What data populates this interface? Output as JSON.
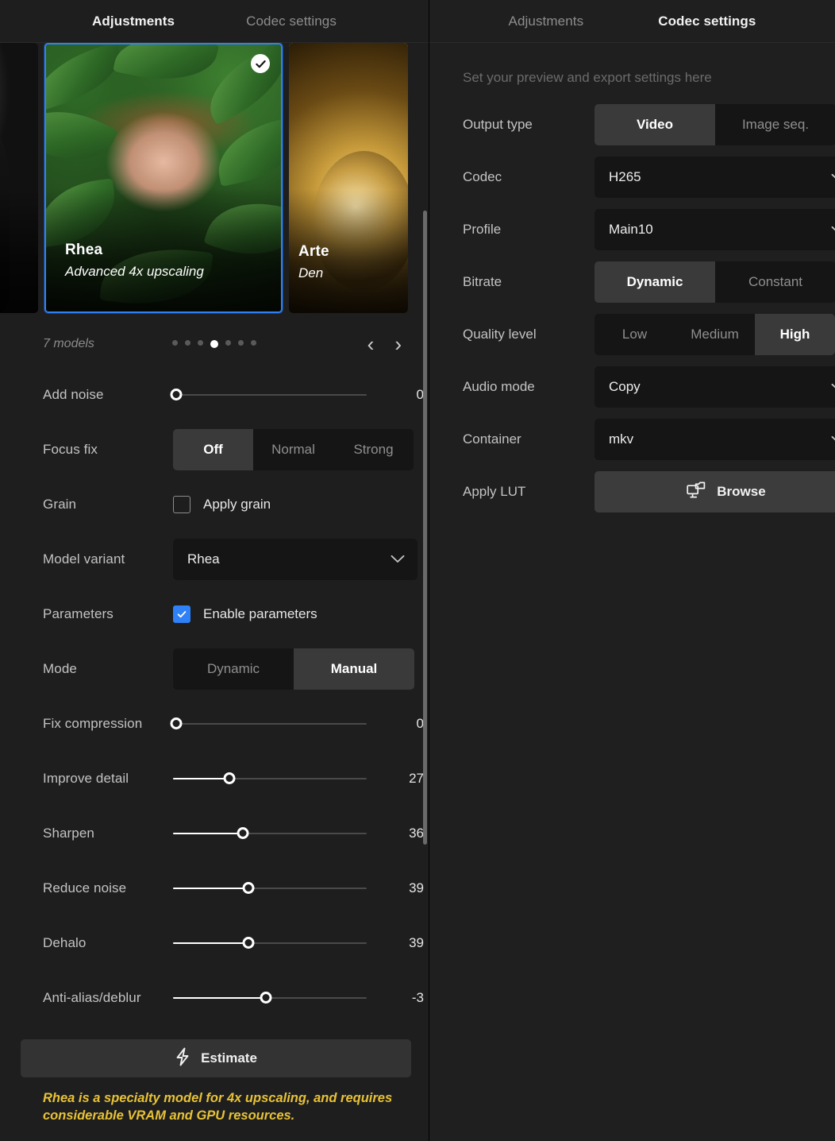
{
  "left_panel": {
    "tabs": [
      {
        "label": "Adjustments",
        "active": true
      },
      {
        "label": "Codec settings",
        "active": false
      }
    ],
    "carousel": {
      "models_count_label": "7 models",
      "cards": [
        {
          "title": "",
          "subtitle": "",
          "art": "dark",
          "selected": false
        },
        {
          "title": "Rhea",
          "subtitle": "Advanced 4x upscaling",
          "art": "leaf",
          "selected": true,
          "badge_icon": "check-icon"
        },
        {
          "title": "Arte",
          "subtitle": "Den",
          "art": "gold",
          "selected": false
        }
      ],
      "dots_total": 7,
      "dots_active_index": 3,
      "prev_icon": "chevron-left-icon",
      "next_icon": "chevron-right-icon",
      "prev_glyph": "‹",
      "next_glyph": "›"
    },
    "rows": {
      "add_noise": {
        "label": "Add noise",
        "value": "0",
        "percent": 0
      },
      "focus_fix": {
        "label": "Focus fix",
        "options": [
          "Off",
          "Normal",
          "Strong"
        ],
        "selected": "Off"
      },
      "grain": {
        "label": "Grain",
        "checkbox_label": "Apply grain",
        "checked": false
      },
      "model_variant": {
        "label": "Model variant",
        "value": "Rhea"
      },
      "parameters": {
        "label": "Parameters",
        "checkbox_label": "Enable parameters",
        "checked": true
      },
      "mode": {
        "label": "Mode",
        "options": [
          "Dynamic",
          "Manual"
        ],
        "selected": "Manual"
      },
      "fix_compression": {
        "label": "Fix compression",
        "value": "0",
        "percent": 0
      },
      "improve_detail": {
        "label": "Improve detail",
        "value": "27",
        "percent": 29
      },
      "sharpen": {
        "label": "Sharpen",
        "value": "36",
        "percent": 36
      },
      "reduce_noise": {
        "label": "Reduce noise",
        "value": "39",
        "percent": 39
      },
      "dehalo": {
        "label": "Dehalo",
        "value": "39",
        "percent": 39
      },
      "anti_alias": {
        "label": "Anti-alias/deblur",
        "value": "-3",
        "percent": 48
      }
    },
    "estimate_button": {
      "label": "Estimate",
      "icon": "lightning-bolt-icon"
    },
    "warning_text": "Rhea is a specialty model for 4x upscaling, and requires considerable VRAM and GPU resources."
  },
  "right_panel": {
    "tabs": [
      {
        "label": "Adjustments",
        "active": false
      },
      {
        "label": "Codec settings",
        "active": true
      }
    ],
    "hint": "Set your preview and export settings here",
    "rows": {
      "output_type": {
        "label": "Output type",
        "options": [
          "Video",
          "Image seq."
        ],
        "selected": "Video"
      },
      "codec": {
        "label": "Codec",
        "value": "H265"
      },
      "profile": {
        "label": "Profile",
        "value": "Main10"
      },
      "bitrate": {
        "label": "Bitrate",
        "options": [
          "Dynamic",
          "Constant"
        ],
        "selected": "Dynamic"
      },
      "quality_level": {
        "label": "Quality level",
        "options": [
          "Low",
          "Medium",
          "High"
        ],
        "selected": "High"
      },
      "audio_mode": {
        "label": "Audio mode",
        "value": "Copy"
      },
      "container": {
        "label": "Container",
        "value": "mkv"
      },
      "apply_lut": {
        "label": "Apply LUT",
        "button_label": "Browse",
        "icon": "monitor-folder-icon"
      }
    }
  },
  "colors": {
    "accent_blue": "#2f81f7",
    "warning_yellow": "#e8c236",
    "panel_bg": "#1e1e1e",
    "control_bg": "#151515",
    "control_active": "#3a3a3a"
  }
}
